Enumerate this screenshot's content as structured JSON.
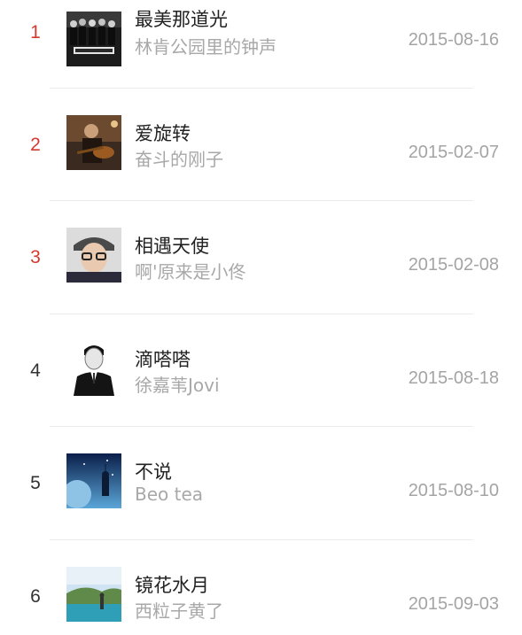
{
  "songs": [
    {
      "rank": "1",
      "title": "最美那道光",
      "artist": "林肯公园里的钟声",
      "date": "2015-08-16",
      "cover": "band-cover-icon"
    },
    {
      "rank": "2",
      "title": "爱旋转",
      "artist": "奋斗的刚子",
      "date": "2015-02-07",
      "cover": "guitarist-cover-icon"
    },
    {
      "rank": "3",
      "title": "相遇天使",
      "artist": "啊'原来是小佟",
      "date": "2015-02-08",
      "cover": "portrait-cover-icon"
    },
    {
      "rank": "4",
      "title": "滴嗒嗒",
      "artist": "徐嘉苇Jovi",
      "date": "2015-08-18",
      "cover": "suit-portrait-cover-icon"
    },
    {
      "rank": "5",
      "title": "不说",
      "artist": "Beo tea",
      "date": "2015-08-10",
      "cover": "night-sky-cover-icon"
    },
    {
      "rank": "6",
      "title": "镜花水月",
      "artist": "西粒子黄了",
      "date": "2015-09-03",
      "cover": "landscape-cover-icon"
    }
  ],
  "colors": {
    "top_rank": "#d33a31",
    "rank": "#333333",
    "title": "#222222",
    "secondary": "#a8a8a8",
    "divider": "#ececec"
  }
}
